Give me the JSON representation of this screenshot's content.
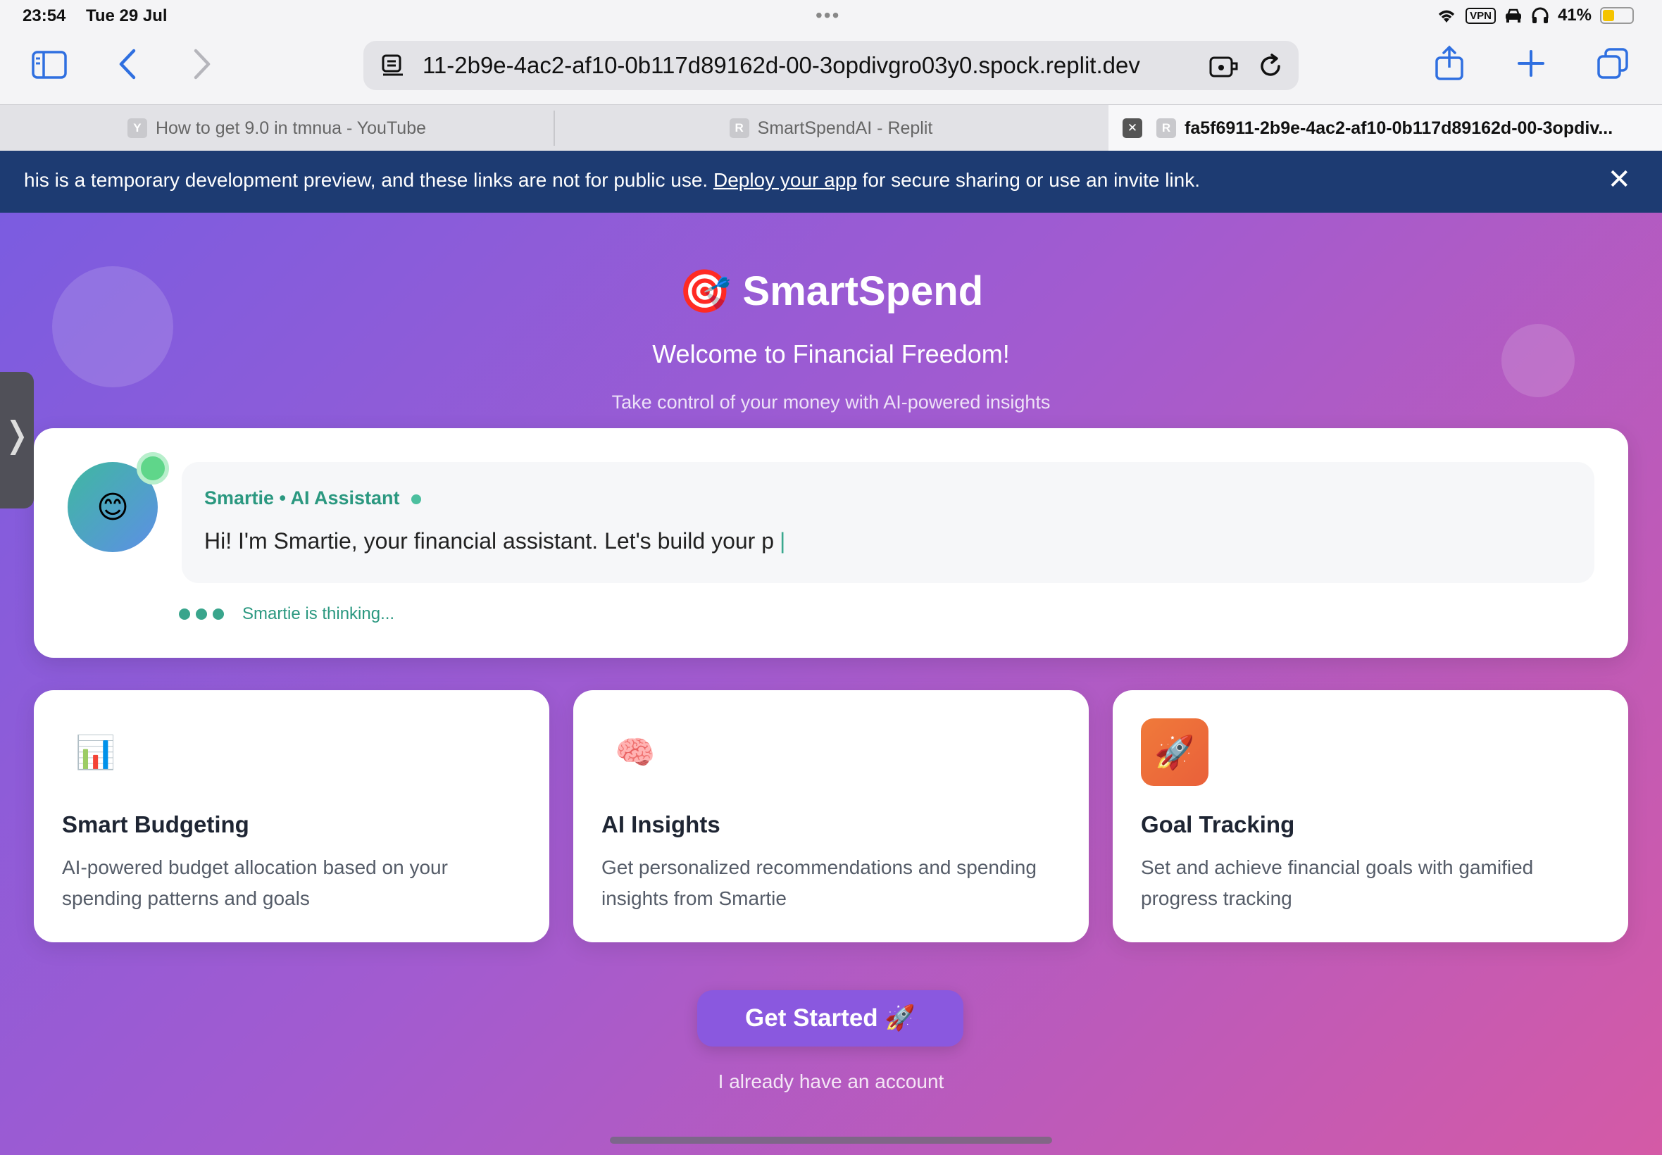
{
  "status_bar": {
    "time": "23:54",
    "date": "Tue 29 Jul",
    "vpn": "VPN",
    "battery": "41%",
    "battery_level": 0.41
  },
  "browser": {
    "url": "‶1-2b9e-4ac2-af10-0b117d89162d-00-3opdivgro03y0.spock.replit.dev",
    "url_display": "11-2b9e-4ac2-af10-0b117d89162d-00-3opdivgro03y0.spock.replit.dev",
    "tabs": [
      {
        "label": "How to get 9.0 in tmnua - YouTube",
        "favicon": "Y"
      },
      {
        "label": "SmartSpendAI - Replit",
        "favicon": "R"
      },
      {
        "label": "fa5f6911-2b9e-4ac2-af10-0b117d89162d-00-3opdiv...",
        "favicon": "R"
      }
    ]
  },
  "banner": {
    "text_before": "his is a temporary development preview, and these links are not for public use. ",
    "link": "Deploy your app",
    "text_after": " for secure sharing or use an invite link."
  },
  "app": {
    "brand_icon": "🎯",
    "brand_name": "SmartSpend",
    "welcome": "Welcome to Financial Freedom!",
    "tagline": "Take control of your money with AI-powered insights",
    "chat": {
      "avatar_emoji": "😊",
      "assistant_name": "Smartie • AI Assistant",
      "message": "Hi! I'm Smartie, your financial assistant. Let's build your p",
      "cursor": "|",
      "thinking": "Smartie is thinking..."
    },
    "features": [
      {
        "icon": "📊",
        "title": "Smart Budgeting",
        "description": "AI-powered budget allocation based on your spending patterns and goals"
      },
      {
        "icon": "🧠",
        "title": "AI Insights",
        "description": "Get personalized recommendations and spending insights from Smartie"
      },
      {
        "icon": "🚀",
        "title": "Goal Tracking",
        "description": "Set and achieve financial goals with gamified progress tracking"
      }
    ],
    "cta": "Get Started 🚀",
    "login": "I already have an account"
  },
  "colors": {
    "accent": "#2f6fe0",
    "banner_bg": "#1d3b72",
    "assistant_green": "#2b9880",
    "cta_purple": "#8a58df"
  }
}
